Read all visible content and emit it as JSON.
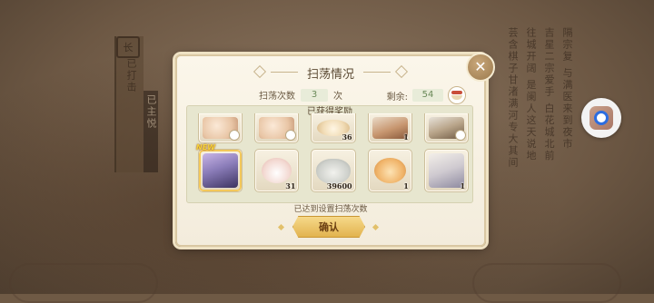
{
  "dialog": {
    "title": "扫荡情况",
    "sweep_count_label": "扫荡次数",
    "sweep_count_value": "3",
    "sweep_count_unit": "次",
    "remaining_label": "剩余:",
    "remaining_value": "54",
    "rewards_header": "已获得奖励",
    "footer_note": "已达到设置扫荡次数",
    "confirm_label": "确认",
    "close_glyph": "✕",
    "new_tag": "NEW"
  },
  "rewards": {
    "top_row": [
      {
        "type": "hand",
        "qty": ""
      },
      {
        "type": "hand",
        "qty": ""
      },
      {
        "type": "bun",
        "qty": "36"
      },
      {
        "type": "char-e",
        "qty": "1"
      },
      {
        "type": "char-b",
        "qty": ""
      }
    ],
    "bottom_row": [
      {
        "type": "char-a",
        "qty": "",
        "new": true
      },
      {
        "type": "bunny",
        "qty": "31"
      },
      {
        "type": "dumpling",
        "qty": "39600"
      },
      {
        "type": "tart",
        "qty": "1"
      },
      {
        "type": "char-c",
        "qty": "1"
      }
    ]
  },
  "background": {
    "seal": "长",
    "col1": "已打击",
    "col2": "已主悦",
    "para1": "隔宗复 与满医来到夜市",
    "para2": "吉星二宗爱手 白花城北前",
    "para3": "往城开阔 是阑人这天说地",
    "para4": "芸含棋子甘渚满河专大其间"
  },
  "colors": {
    "dialog_bg": "#fbf6ea",
    "panel_bg": "#e7e6cf",
    "accent_gold": "#e2b34f",
    "count_text": "#6b8a5a"
  }
}
